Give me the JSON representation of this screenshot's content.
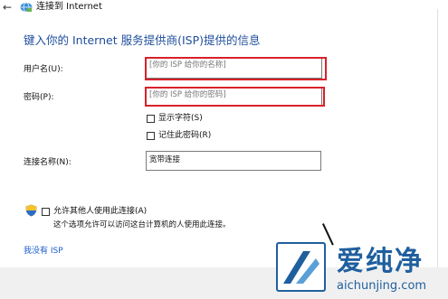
{
  "window": {
    "back_glyph": "←",
    "title": "连接到 Internet",
    "title_icon": "network-globe-icon"
  },
  "heading": "键入你的 Internet 服务提供商(ISP)提供的信息",
  "username": {
    "label": "用户名(U):",
    "placeholder": "[你的 ISP 给你的名称]"
  },
  "password": {
    "label": "密码(P):",
    "placeholder": "[你的 ISP 给你的密码]"
  },
  "options": {
    "show_chars": "显示字符(S)",
    "remember_password": "记住此密码(R)"
  },
  "connection_name": {
    "label": "连接名称(N):",
    "value": "宽带连接"
  },
  "allow_others": {
    "label": "允许其他人使用此连接(A)",
    "hint": "这个选项允许可以访问这台计算机的人使用此连接。",
    "icon": "shield-icon"
  },
  "no_isp_link": "我没有 ISP",
  "watermark": {
    "brand": "爱纯净",
    "domain": "aichunjing.com"
  },
  "colors": {
    "heading": "#1f4e9c",
    "highlight": "#d9212a",
    "link": "#1c5ccf",
    "watermark": "#1f5f9e"
  }
}
